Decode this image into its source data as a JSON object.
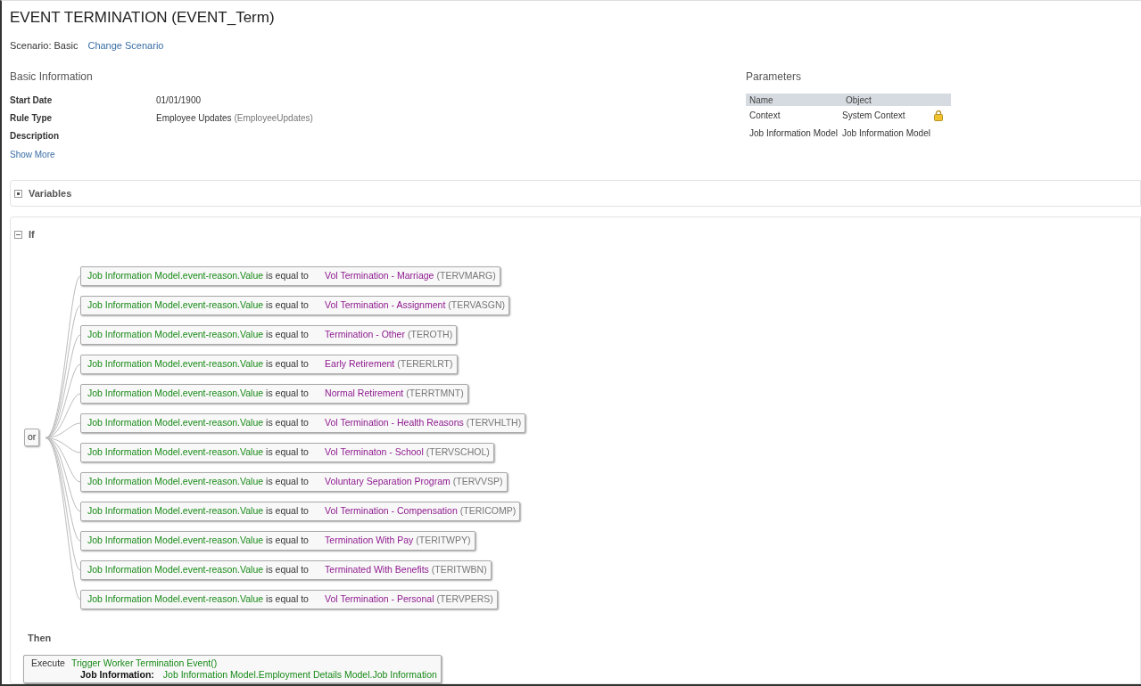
{
  "title": "EVENT TERMINATION (EVENT_Term)",
  "scenario": {
    "label": "Scenario: Basic",
    "link": "Change Scenario"
  },
  "basic_information": {
    "heading": "Basic Information",
    "fields": [
      {
        "label": "Start Date",
        "value": "01/01/1900"
      },
      {
        "label": "Rule Type",
        "value": "Employee Updates",
        "code": "(EmployeeUpdates)"
      },
      {
        "label": "Description"
      }
    ],
    "show_more": "Show More"
  },
  "parameters": {
    "heading": "Parameters",
    "columns": [
      "Name",
      "Object"
    ],
    "rows": [
      {
        "name": "Context",
        "object": "System Context",
        "locked": true
      },
      {
        "name": "Job Information Model",
        "object": "Job Information Model",
        "locked": false
      }
    ]
  },
  "variables": {
    "label": "Variables",
    "expanded": false
  },
  "if": {
    "label": "If",
    "expanded": true,
    "operator": "or",
    "conditions": [
      {
        "left": "Job Information Model.event-reason.Value",
        "comparison": "is equal to",
        "value": "Vol Termination - Marriage",
        "code": "(TERVMARG)"
      },
      {
        "left": "Job Information Model.event-reason.Value",
        "comparison": "is equal to",
        "value": "Vol Termination - Assignment",
        "code": "(TERVASGN)"
      },
      {
        "left": "Job Information Model.event-reason.Value",
        "comparison": "is equal to",
        "value": "Termination - Other",
        "code": "(TEROTH)"
      },
      {
        "left": "Job Information Model.event-reason.Value",
        "comparison": "is equal to",
        "value": "Early Retirement",
        "code": "(TERERLRT)"
      },
      {
        "left": "Job Information Model.event-reason.Value",
        "comparison": "is equal to",
        "value": "Normal Retirement",
        "code": "(TERRTMNT)"
      },
      {
        "left": "Job Information Model.event-reason.Value",
        "comparison": "is equal to",
        "value": "Vol Termination - Health Reasons",
        "code": "(TERVHLTH)"
      },
      {
        "left": "Job Information Model.event-reason.Value",
        "comparison": "is equal to",
        "value": "Vol Terminaton - School",
        "code": "(TERVSCHOL)"
      },
      {
        "left": "Job Information Model.event-reason.Value",
        "comparison": "is equal to",
        "value": "Voluntary Separation Program",
        "code": "(TERVVSP)"
      },
      {
        "left": "Job Information Model.event-reason.Value",
        "comparison": "is equal to",
        "value": "Vol Termination - Compensation",
        "code": "(TERICOMP)"
      },
      {
        "left": "Job Information Model.event-reason.Value",
        "comparison": "is equal to",
        "value": "Termination With Pay",
        "code": "(TERITWPY)"
      },
      {
        "left": "Job Information Model.event-reason.Value",
        "comparison": "is equal to",
        "value": "Terminated With Benefits",
        "code": "(TERITWBN)"
      },
      {
        "left": "Job Information Model.event-reason.Value",
        "comparison": "is equal to",
        "value": "Vol Termination - Personal",
        "code": "(TERVPERS)"
      }
    ]
  },
  "then": {
    "label": "Then",
    "action": "Execute",
    "function": "Trigger Worker Termination Event()",
    "parameter_label": "Job Information:",
    "parameter_value": "Job Information Model.Employment Details Model.Job Information"
  }
}
